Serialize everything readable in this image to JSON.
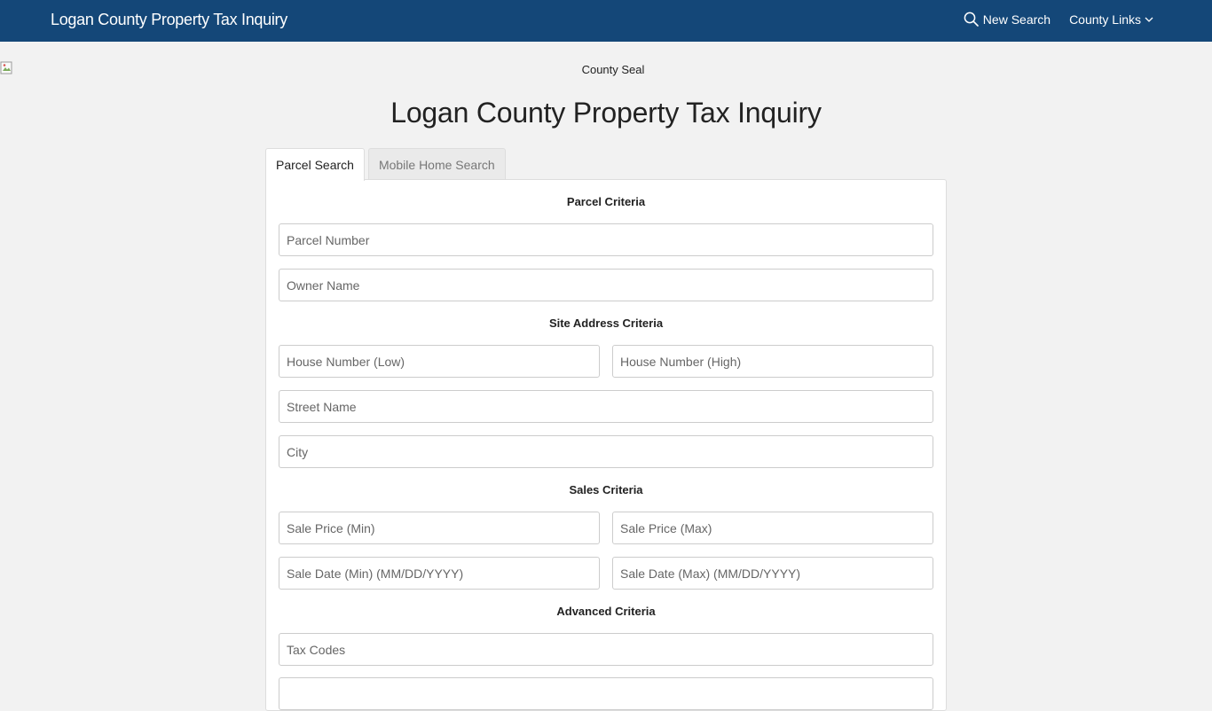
{
  "navbar": {
    "brand": "Logan County Property Tax Inquiry",
    "new_search": "New Search",
    "county_links": "County Links"
  },
  "header": {
    "seal_alt": "County Seal",
    "title": "Logan County Property Tax Inquiry"
  },
  "tabs": [
    {
      "label": "Parcel Search"
    },
    {
      "label": "Mobile Home Search"
    }
  ],
  "form": {
    "sections": {
      "parcel": "Parcel Criteria",
      "site": "Site Address Criteria",
      "sales": "Sales Criteria",
      "advanced": "Advanced Criteria"
    },
    "fields": {
      "parcel_number": "Parcel Number",
      "owner_name": "Owner Name",
      "house_low": "House Number (Low)",
      "house_high": "House Number (High)",
      "street_name": "Street Name",
      "city": "City",
      "sale_price_min": "Sale Price (Min)",
      "sale_price_max": "Sale Price (Max)",
      "sale_date_min": "Sale Date (Min) (MM/DD/YYYY)",
      "sale_date_max": "Sale Date (Max) (MM/DD/YYYY)",
      "tax_codes": "Tax Codes"
    }
  },
  "icons": {
    "search": "search-icon",
    "chevron": "chevron-down-icon",
    "seal": "broken-image-icon"
  },
  "colors": {
    "navbar": "#144778",
    "background": "#f2f2f2"
  }
}
